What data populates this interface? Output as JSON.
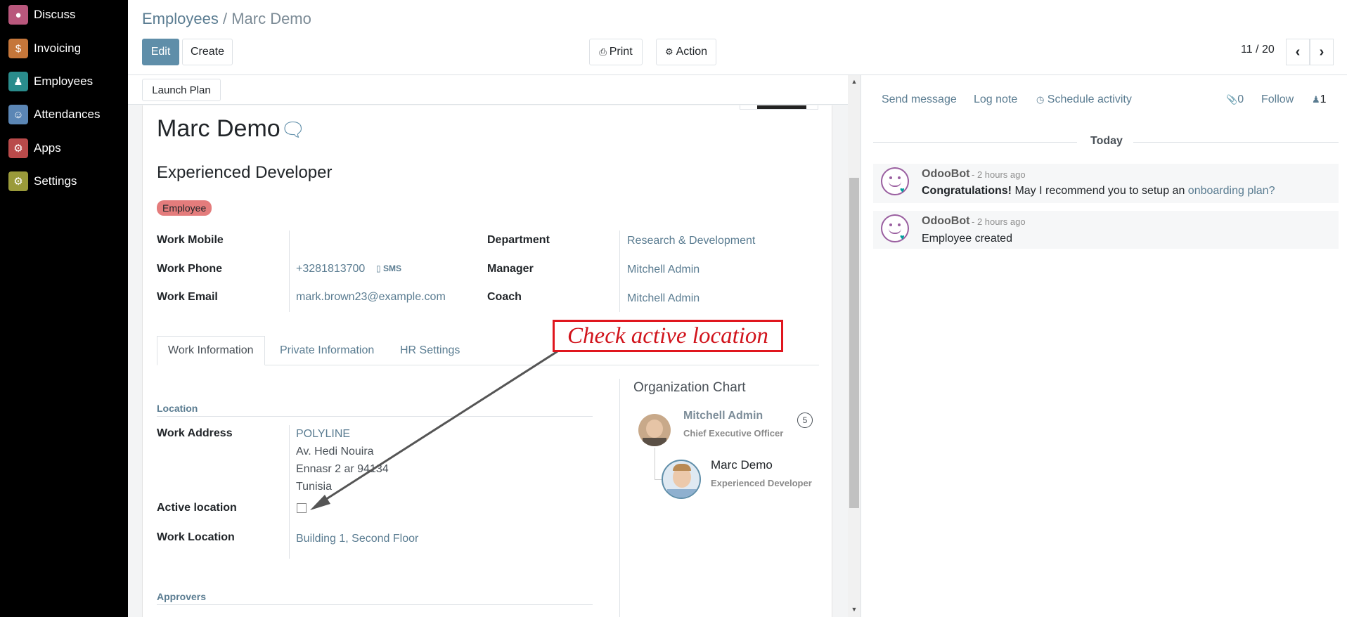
{
  "sidebar": {
    "items": [
      {
        "label": "Discuss",
        "icon": "chat-bubble-icon",
        "color": "#b9577c"
      },
      {
        "label": "Invoicing",
        "icon": "invoice-icon",
        "color": "#c5763a"
      },
      {
        "label": "Employees",
        "icon": "people-icon",
        "color": "#2a8c8c"
      },
      {
        "label": "Attendances",
        "icon": "attendance-icon",
        "color": "#5b86b5"
      },
      {
        "label": "Apps",
        "icon": "apps-icon",
        "color": "#b94a4a"
      },
      {
        "label": "Settings",
        "icon": "gear-icon",
        "color": "#9a9a3a"
      }
    ]
  },
  "breadcrumb": {
    "parent": "Employees",
    "separator": " / ",
    "current": "Marc Demo"
  },
  "toolbar": {
    "edit": "Edit",
    "create": "Create",
    "print": "Print",
    "action": "Action"
  },
  "pager": {
    "value": "11 / 20"
  },
  "statusbar": {
    "launch_plan": "Launch Plan"
  },
  "employee": {
    "name": "Marc Demo",
    "job_title": "Experienced Developer",
    "tag": "Employee",
    "fields_left": [
      {
        "label": "Work Mobile",
        "value": ""
      },
      {
        "label": "Work Phone",
        "value": "+3281813700",
        "extra": "SMS"
      },
      {
        "label": "Work Email",
        "value": "mark.brown23@example.com"
      }
    ],
    "fields_right": [
      {
        "label": "Department",
        "value": "Research & Development"
      },
      {
        "label": "Manager",
        "value": "Mitchell Admin"
      },
      {
        "label": "Coach",
        "value": "Mitchell Admin"
      }
    ]
  },
  "tabs": [
    "Work Information",
    "Private Information",
    "HR Settings"
  ],
  "work_info": {
    "location_section": "Location",
    "work_address_label": "Work Address",
    "work_address": [
      "POLYLINE",
      "Av. Hedi Nouira",
      "Ennasr 2 ar 94134",
      "Tunisia"
    ],
    "active_location_label": "Active location",
    "active_location_checked": false,
    "work_location_label": "Work Location",
    "work_location": "Building 1, Second Floor",
    "approvers_section": "Approvers"
  },
  "org_chart": {
    "title": "Organization Chart",
    "manager_name": "Mitchell Admin",
    "manager_title": "Chief Executive Officer",
    "manager_count": "5",
    "employee_name": "Marc Demo",
    "employee_title": "Experienced Developer"
  },
  "annotation": {
    "text": "Check active location",
    "color": "#e0161e"
  },
  "chatter": {
    "send_message": "Send message",
    "log_note": "Log note",
    "schedule_activity": "Schedule activity",
    "attachments": "0",
    "follow": "Follow",
    "followers": "1",
    "date_separator": "Today",
    "messages": [
      {
        "author": "OdooBot",
        "time": "- 2 hours ago",
        "bold": "Congratulations!",
        "text": " May I recommend you to setup an ",
        "link": "onboarding plan?"
      },
      {
        "author": "OdooBot",
        "time": "- 2 hours ago",
        "text": "Employee created"
      }
    ]
  }
}
